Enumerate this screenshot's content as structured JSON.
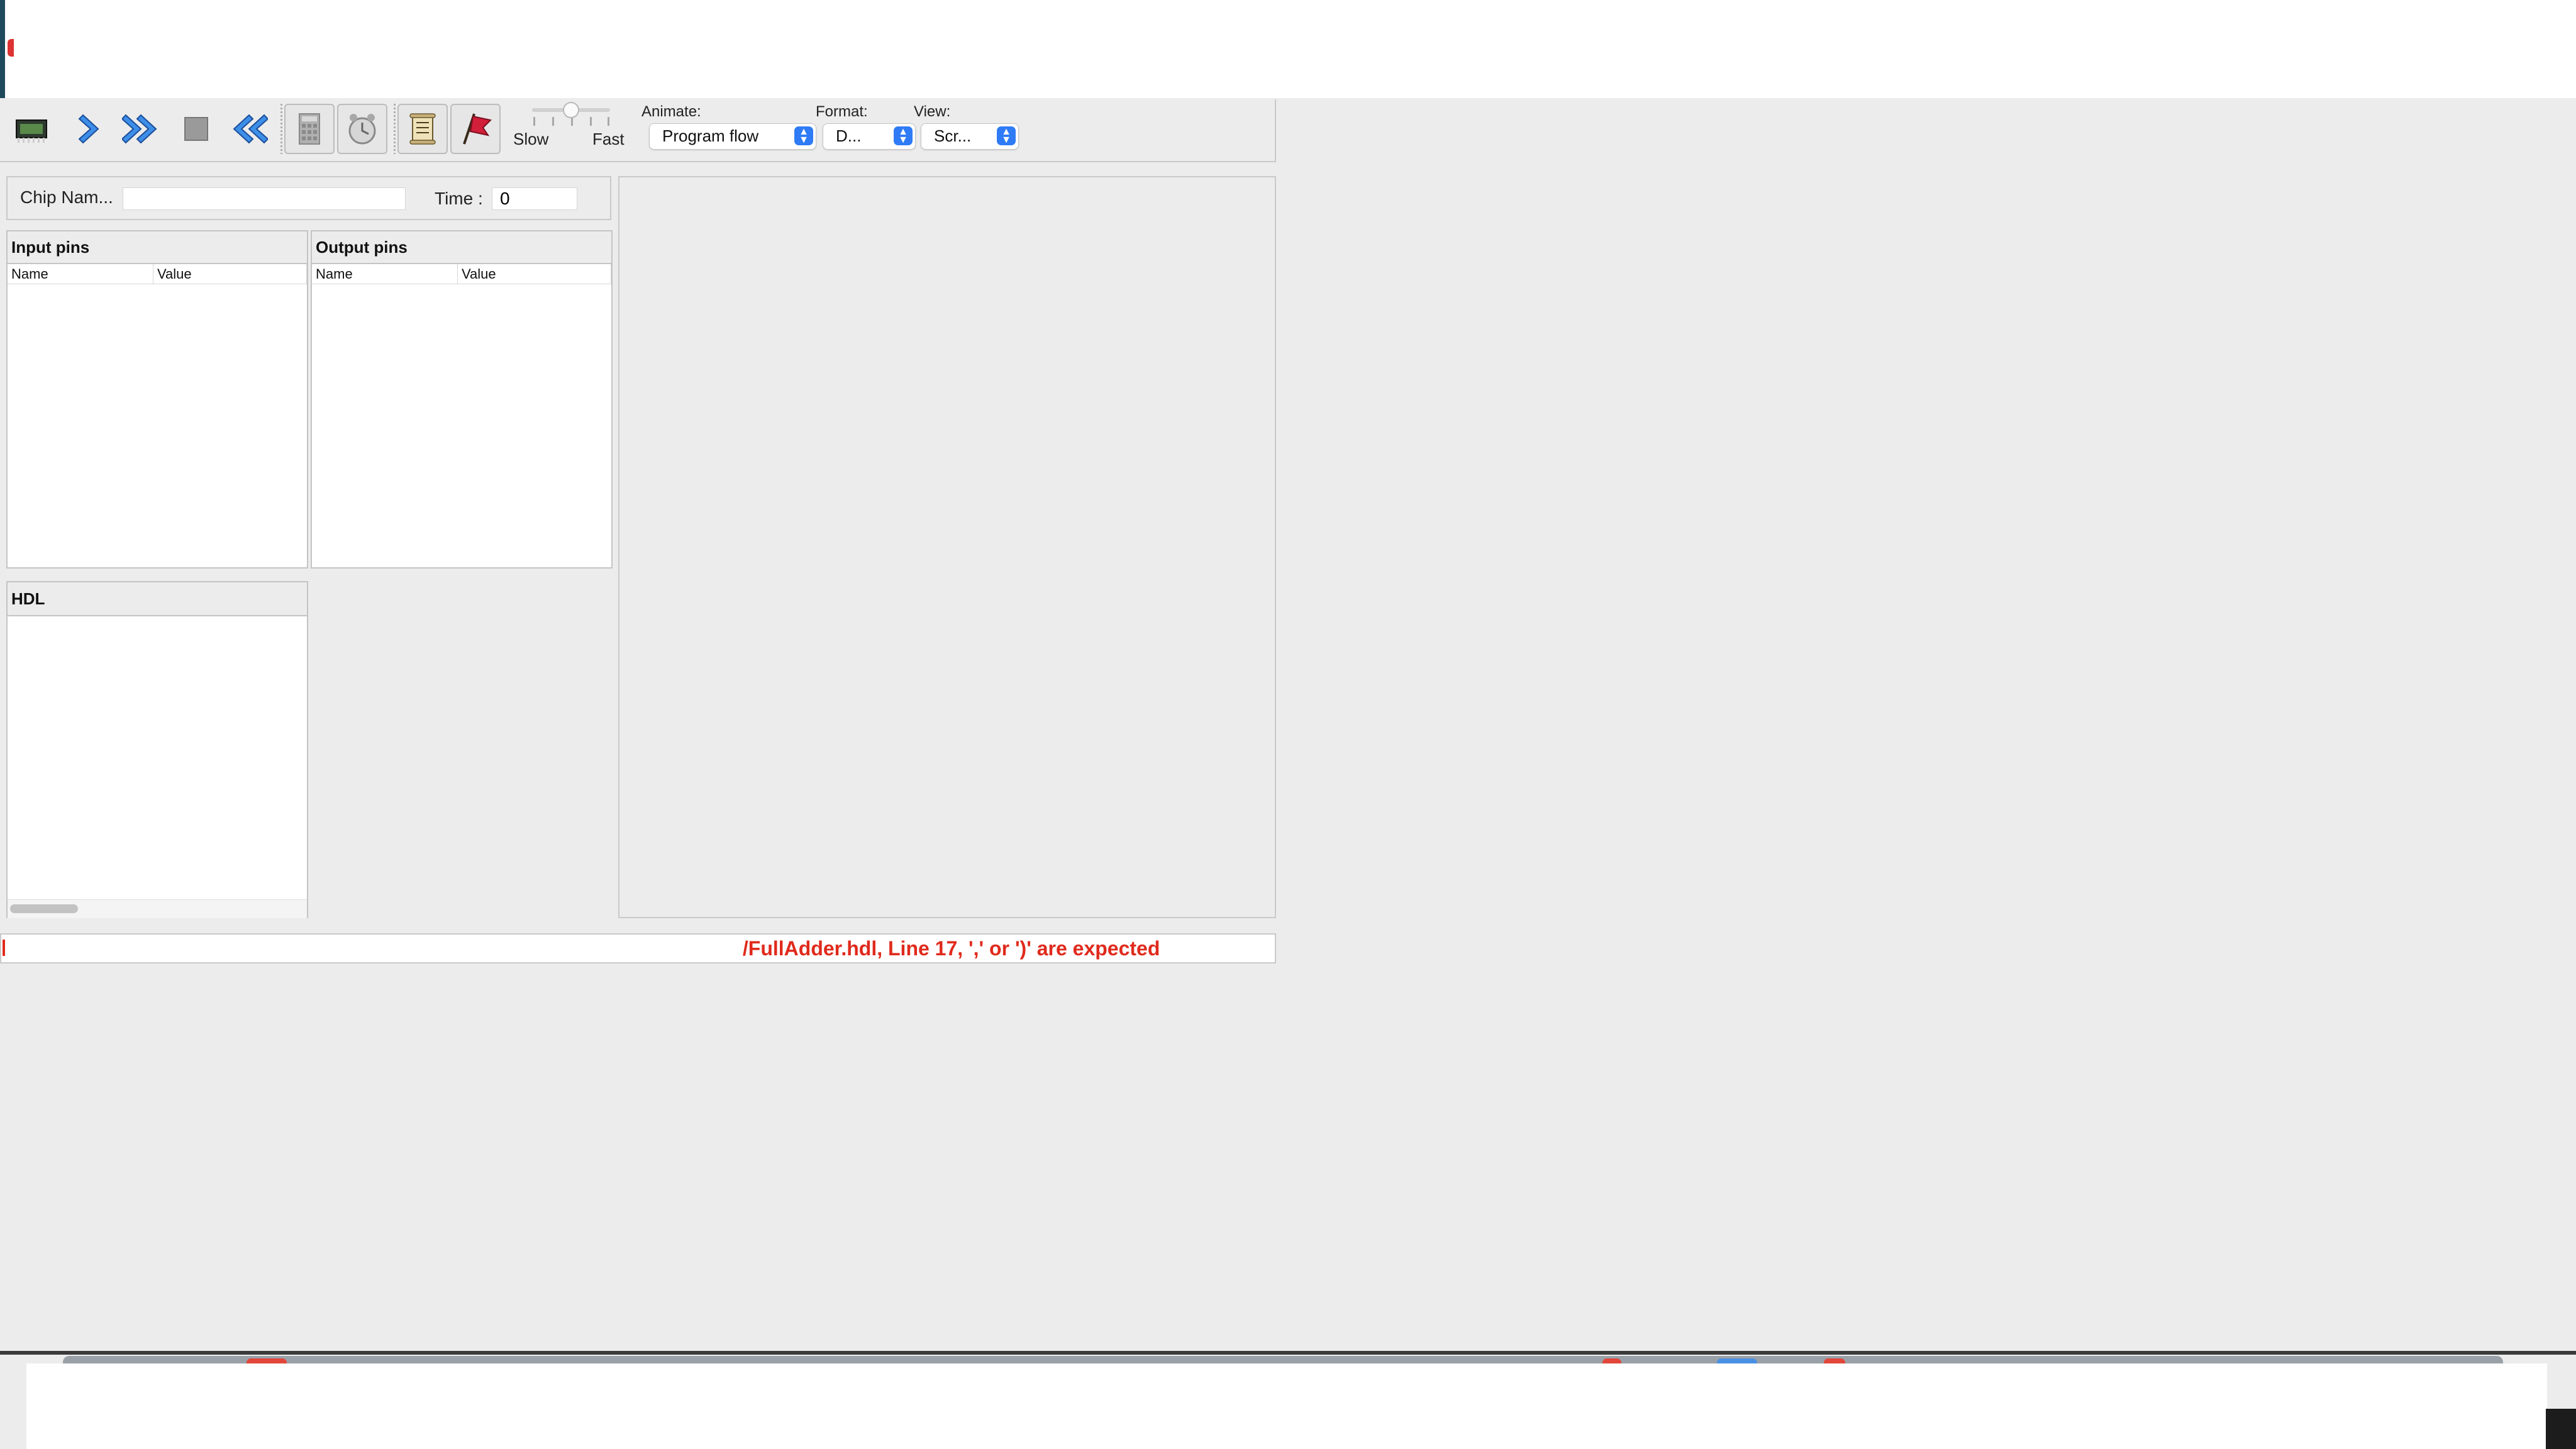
{
  "toolbar": {
    "buttons": [
      {
        "name": "load-chip",
        "icon": "chip-icon"
      },
      {
        "name": "single-step",
        "icon": "chevron-right-icon"
      },
      {
        "name": "run",
        "icon": "double-chevron-right-icon"
      },
      {
        "name": "stop",
        "icon": "stop-icon"
      },
      {
        "name": "reset",
        "icon": "double-chevron-left-icon"
      },
      {
        "name": "eval",
        "icon": "calculator-icon"
      },
      {
        "name": "tick-tock",
        "icon": "clock-icon"
      },
      {
        "name": "script",
        "icon": "scroll-icon"
      },
      {
        "name": "breakpoints",
        "icon": "flag-icon"
      }
    ],
    "speed": {
      "slow_label": "Slow",
      "fast_label": "Fast"
    },
    "animate": {
      "label": "Animate:",
      "value": "Program flow"
    },
    "format": {
      "label": "Format:",
      "value": "D..."
    },
    "view": {
      "label": "View:",
      "value": "Scr..."
    }
  },
  "chip": {
    "name_label": "Chip Nam...",
    "name_value": "",
    "time_label": "Time :",
    "time_value": "0"
  },
  "input_pins": {
    "title": "Input pins",
    "columns": [
      "Name",
      "Value"
    ]
  },
  "output_pins": {
    "title": "Output pins",
    "columns": [
      "Name",
      "Value"
    ]
  },
  "hdl": {
    "title": "HDL"
  },
  "status": {
    "message": " /FullAdder.hdl, Line 17, ',' or ')' are expected",
    "color": "#e02a1c"
  },
  "colors": {
    "accent": "#2f7bf5",
    "error": "#e02a1c",
    "background": "#ececec"
  }
}
